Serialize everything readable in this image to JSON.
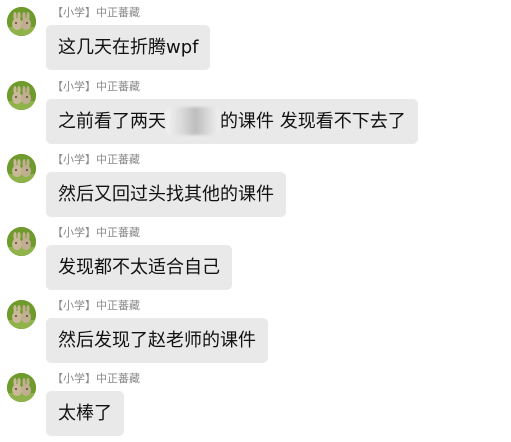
{
  "sender": {
    "tag": "【小学】",
    "name": "中正蕃藏"
  },
  "messages": [
    {
      "text": "这几天在折腾wpf"
    },
    {
      "text_before": "之前看了两天",
      "text_after": "的课件 发现看不下去了"
    },
    {
      "text": "然后又回过头找其他的课件"
    },
    {
      "text": "发现都不太适合自己"
    },
    {
      "text": "然后发现了赵老师的课件"
    },
    {
      "text": "太棒了"
    }
  ],
  "colors": {
    "bubble": "#e9e9e9",
    "sender_text": "#8a8a8a",
    "message_text": "#111111",
    "background": "#ffffff"
  },
  "icons": {
    "avatar": "rabbit-avatar-icon",
    "redaction": "blurred-text-patch"
  }
}
